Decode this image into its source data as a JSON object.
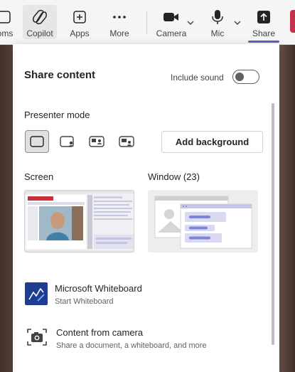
{
  "toolbar": {
    "items": [
      {
        "label": "oms",
        "icon": "rooms-icon"
      },
      {
        "label": "Copilot",
        "icon": "copilot-icon"
      },
      {
        "label": "Apps",
        "icon": "apps-icon"
      },
      {
        "label": "More",
        "icon": "more-icon"
      },
      {
        "label": "Camera",
        "icon": "camera-icon"
      },
      {
        "label": "Mic",
        "icon": "mic-icon"
      },
      {
        "label": "Share",
        "icon": "share-icon"
      }
    ],
    "accent": "#5b5fc7",
    "leave_color": "#c4314b"
  },
  "panel": {
    "title": "Share content",
    "include_sound": {
      "label": "Include sound",
      "on": false
    },
    "presenter_mode": {
      "label": "Presenter mode",
      "modes": [
        "content-only",
        "standout",
        "side-by-side",
        "reporter"
      ],
      "selected": 0,
      "add_background_label": "Add background"
    },
    "screen": {
      "label": "Screen"
    },
    "window": {
      "label": "Window (23)"
    },
    "options": [
      {
        "title": "Microsoft Whiteboard",
        "subtitle": "Start Whiteboard",
        "icon": "whiteboard-icon"
      },
      {
        "title": "Content from camera",
        "subtitle": "Share a document, a whiteboard, and more",
        "icon": "camera-content-icon"
      }
    ]
  }
}
